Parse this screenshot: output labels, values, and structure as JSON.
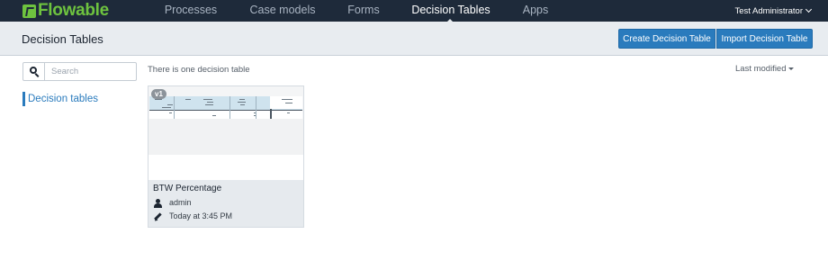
{
  "app": {
    "logo_text": "Flowable"
  },
  "nav": {
    "items": [
      {
        "label": "Processes"
      },
      {
        "label": "Case models"
      },
      {
        "label": "Forms"
      },
      {
        "label": "Decision Tables"
      },
      {
        "label": "Apps"
      }
    ],
    "active": "Decision Tables",
    "user_label": "Test Administrator"
  },
  "header": {
    "title": "Decision Tables",
    "create_button": "Create Decision Table",
    "import_button": "Import Decision Table"
  },
  "sidebar": {
    "search_placeholder": "Search",
    "filters": [
      {
        "label": "Decision tables"
      }
    ]
  },
  "main": {
    "count_text": "There is one decision table",
    "sort_label": "Last modified"
  },
  "cards": [
    {
      "version": "v1",
      "title": "BTW Percentage",
      "author": "admin",
      "modified": "Today at 3:45 PM"
    }
  ],
  "colors": {
    "navbar": "#1e2a3a",
    "brand": "#6ec33f",
    "primary": "#2a7bbd"
  }
}
